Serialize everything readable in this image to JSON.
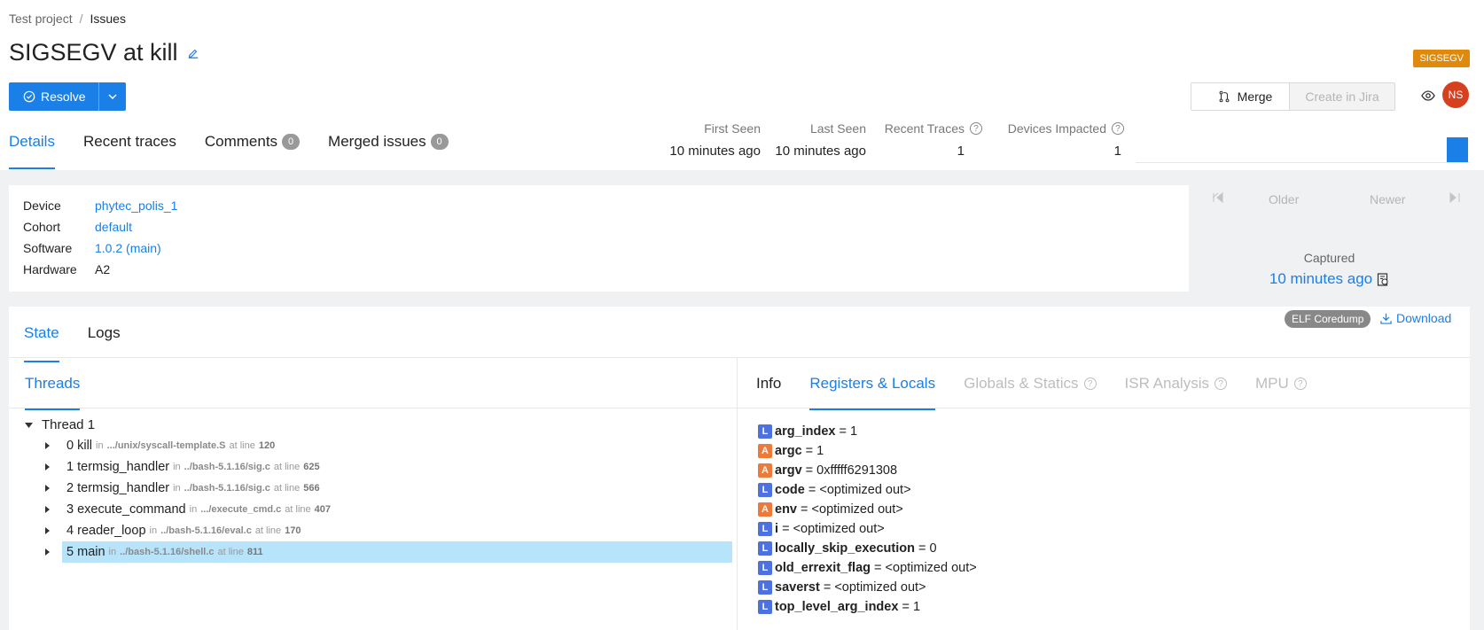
{
  "breadcrumb": {
    "project": "Test project",
    "separator": "/",
    "current": "Issues"
  },
  "issue": {
    "title": "SIGSEGV at kill",
    "signal_tag": "SIGSEGV"
  },
  "actions": {
    "resolve_label": "Resolve",
    "merge_label": "Merge",
    "jira_label": "Create in Jira",
    "avatar_initials": "NS"
  },
  "tabs": [
    {
      "label": "Details",
      "count": null
    },
    {
      "label": "Recent traces",
      "count": null
    },
    {
      "label": "Comments",
      "count": "0"
    },
    {
      "label": "Merged issues",
      "count": "0"
    }
  ],
  "stats": {
    "first_seen": {
      "label": "First Seen",
      "value": "10 minutes ago"
    },
    "last_seen": {
      "label": "Last Seen",
      "value": "10 minutes ago"
    },
    "recent_traces": {
      "label": "Recent Traces",
      "value": "1"
    },
    "devices_impacted": {
      "label": "Devices Impacted",
      "value": "1"
    }
  },
  "device": [
    {
      "key": "Device",
      "value": "phytec_polis_1",
      "link": true
    },
    {
      "key": "Cohort",
      "value": "default",
      "link": true
    },
    {
      "key": "Software",
      "value": "1.0.2 (main)",
      "link": true
    },
    {
      "key": "Hardware",
      "value": "A2",
      "link": false
    }
  ],
  "trace_nav": {
    "older": "Older",
    "newer": "Newer",
    "captured_label": "Captured",
    "captured_value": "10 minutes ago"
  },
  "state_tabs": [
    "State",
    "Logs"
  ],
  "elf_badge": "ELF Coredump",
  "download_label": "Download",
  "threads": {
    "tab_label": "Threads",
    "thread_name": "Thread 1",
    "frames": [
      {
        "idx": "0",
        "fn": "kill",
        "in": "in",
        "path": ".../unix/syscall-template.S",
        "at": "at line",
        "line": "120"
      },
      {
        "idx": "1",
        "fn": "termsig_handler",
        "in": "in",
        "path": "../bash-5.1.16/sig.c",
        "at": "at line",
        "line": "625"
      },
      {
        "idx": "2",
        "fn": "termsig_handler",
        "in": "in",
        "path": "../bash-5.1.16/sig.c",
        "at": "at line",
        "line": "566"
      },
      {
        "idx": "3",
        "fn": "execute_command",
        "in": "in",
        "path": ".../execute_cmd.c",
        "at": "at line",
        "line": "407"
      },
      {
        "idx": "4",
        "fn": "reader_loop",
        "in": "in",
        "path": "../bash-5.1.16/eval.c",
        "at": "at line",
        "line": "170"
      },
      {
        "idx": "5",
        "fn": "main",
        "in": "in",
        "path": "../bash-5.1.16/shell.c",
        "at": "at line",
        "line": "811"
      }
    ]
  },
  "right_tabs": [
    "Info",
    "Registers & Locals",
    "Globals & Statics",
    "ISR Analysis",
    "MPU"
  ],
  "variables": [
    {
      "kind": "L",
      "name": "arg_index",
      "eq": "=",
      "value": "1"
    },
    {
      "kind": "A",
      "name": "argc",
      "eq": "=",
      "value": "1"
    },
    {
      "kind": "A",
      "name": "argv",
      "eq": "=",
      "value": "0xfffff6291308"
    },
    {
      "kind": "L",
      "name": "code",
      "eq": "=",
      "value": "<optimized out>"
    },
    {
      "kind": "A",
      "name": "env",
      "eq": "=",
      "value": "<optimized out>"
    },
    {
      "kind": "L",
      "name": "i",
      "eq": "=",
      "value": "<optimized out>"
    },
    {
      "kind": "L",
      "name": "locally_skip_execution",
      "eq": "=",
      "value": "0"
    },
    {
      "kind": "L",
      "name": "old_errexit_flag",
      "eq": "=",
      "value": "<optimized out>"
    },
    {
      "kind": "L",
      "name": "saverst",
      "eq": "=",
      "value": "<optimized out>"
    },
    {
      "kind": "L",
      "name": "top_level_arg_index",
      "eq": "=",
      "value": "1"
    }
  ],
  "colors": {
    "accent": "#1a7fe6",
    "signal": "#df8a0c",
    "avatar": "#d7401f",
    "selected_row": "#b7e3fb"
  }
}
